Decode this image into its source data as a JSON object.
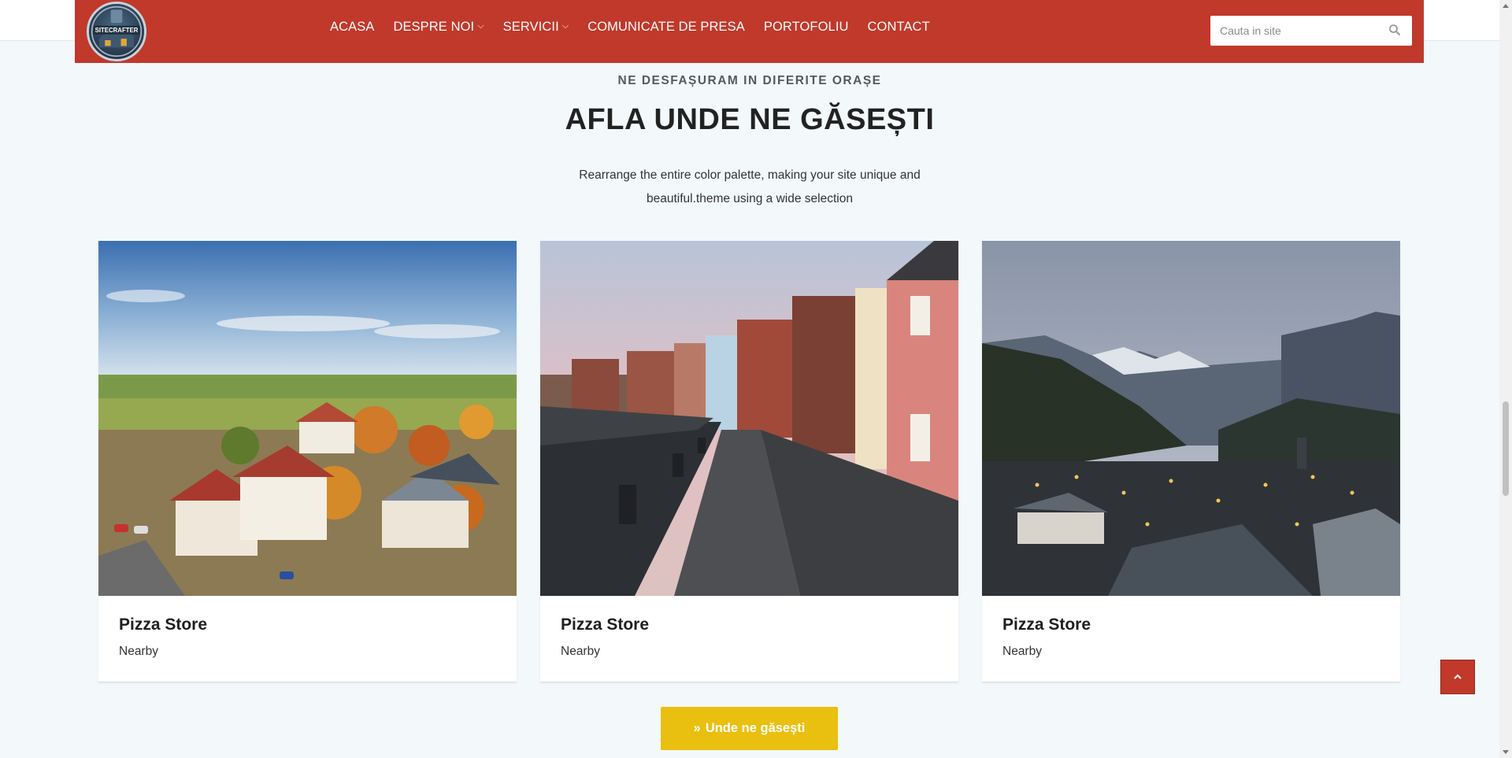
{
  "nav": {
    "logo_text": "SITECRAFTER",
    "items": [
      {
        "label": "ACASA",
        "has_dropdown": false
      },
      {
        "label": "DESPRE NOI",
        "has_dropdown": true
      },
      {
        "label": "SERVICII",
        "has_dropdown": true
      },
      {
        "label": "COMUNICATE DE PRESA",
        "has_dropdown": false
      },
      {
        "label": "PORTOFOLIU",
        "has_dropdown": false
      },
      {
        "label": "CONTACT",
        "has_dropdown": false
      }
    ],
    "search_placeholder": "Cauta in site"
  },
  "section": {
    "eyebrow": "NE DESFAȘURAM IN DIFERITE ORAȘE",
    "title": "AFLA UNDE NE GĂSEȘTI",
    "description_line1": "Rearrange the entire color palette, making your site unique and",
    "description_line2": "beautiful.theme using a wide selection"
  },
  "cards": [
    {
      "title": "Pizza Store",
      "subtitle": "Nearby",
      "image": "autumn-village-aerial"
    },
    {
      "title": "Pizza Store",
      "subtitle": "Nearby",
      "image": "brick-houses-riverside-street"
    },
    {
      "title": "Pizza Store",
      "subtitle": "Nearby",
      "image": "mountain-town-dusk"
    }
  ],
  "cta": {
    "label": "Unde ne găsești",
    "icon": "double-chevron-right-icon"
  },
  "colors": {
    "brand_red": "#c0392b",
    "cta_yellow": "#e9bf10",
    "page_bg": "#f3f8fb"
  }
}
